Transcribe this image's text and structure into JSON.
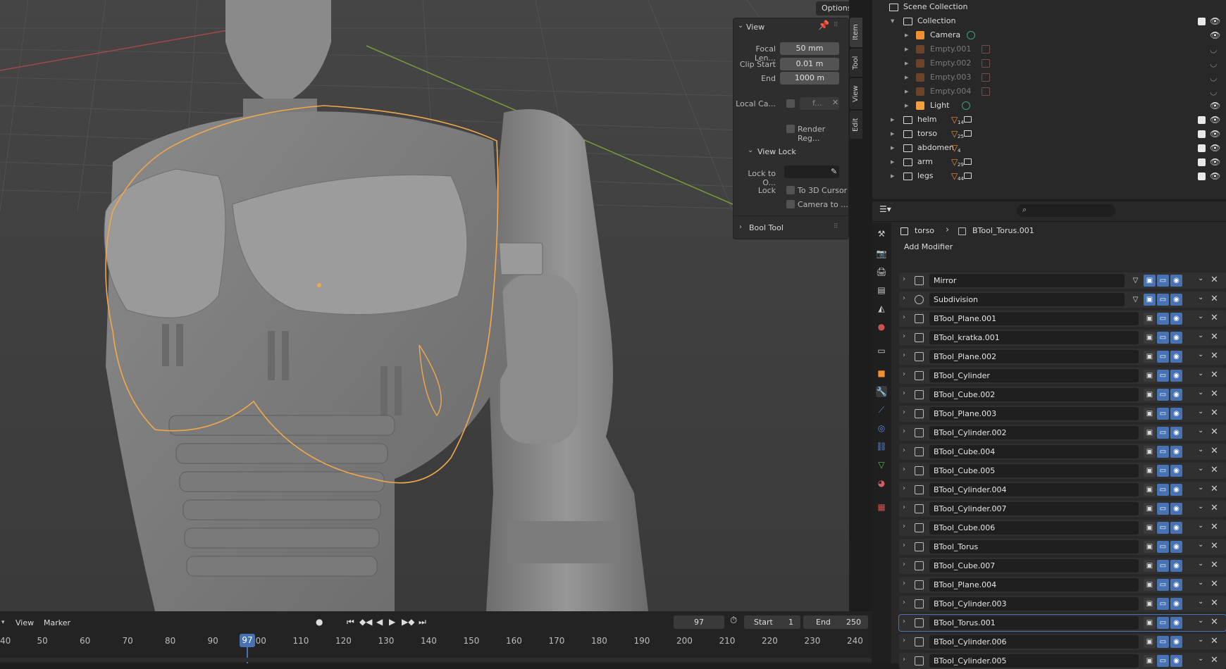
{
  "viewport": {
    "options_label": "Options",
    "npanel": {
      "view_header": "View",
      "focal_length_label": "Focal Len...",
      "focal_length_value": "50 mm",
      "clip_start_label": "Clip Start",
      "clip_start_value": "0.01 m",
      "clip_end_label": "End",
      "clip_end_value": "1000 m",
      "local_camera_label": "Local Ca...",
      "local_camera_value": "f...",
      "render_region_label": "Render Reg...",
      "view_lock_header": "View Lock",
      "lock_to_object_label": "Lock to O...",
      "lock_label": "Lock",
      "to_3d_cursor_label": "To 3D Cursor",
      "camera_to_label": "Camera to ...",
      "bool_tool_header": "Bool Tool"
    },
    "side_tabs": [
      "Item",
      "Tool",
      "View",
      "Edit"
    ]
  },
  "outliner": {
    "scene_collection": "Scene Collection",
    "collection": "Collection",
    "children": [
      {
        "name": "Camera",
        "icon": "camera-icon",
        "dim": false
      },
      {
        "name": "Empty.001",
        "icon": "empty-icon",
        "dim": true
      },
      {
        "name": "Empty.002",
        "icon": "empty-icon",
        "dim": true
      },
      {
        "name": "Empty.003",
        "icon": "empty-icon",
        "dim": true
      },
      {
        "name": "Empty.004",
        "icon": "empty-icon",
        "dim": true
      },
      {
        "name": "Light",
        "icon": "light-icon",
        "dim": false
      }
    ],
    "collections": [
      {
        "name": "helm",
        "count": "14"
      },
      {
        "name": "torso",
        "count": "25"
      },
      {
        "name": "abdomen",
        "count": "4"
      },
      {
        "name": "arm",
        "count": "29"
      },
      {
        "name": "legs",
        "count": "44"
      }
    ]
  },
  "properties": {
    "breadcrumb_object": "torso",
    "breadcrumb_modifier": "BTool_Torus.001",
    "add_modifier_label": "Add Modifier",
    "modifiers": [
      {
        "name": "Mirror",
        "type": "mirror"
      },
      {
        "name": "Subdivision",
        "type": "subdivision"
      },
      {
        "name": "BTool_Plane.001",
        "type": "boolean"
      },
      {
        "name": "BTool_kratka.001",
        "type": "boolean"
      },
      {
        "name": "BTool_Plane.002",
        "type": "boolean"
      },
      {
        "name": "BTool_Cylinder",
        "type": "boolean"
      },
      {
        "name": "BTool_Cube.002",
        "type": "boolean"
      },
      {
        "name": "BTool_Plane.003",
        "type": "boolean"
      },
      {
        "name": "BTool_Cylinder.002",
        "type": "boolean"
      },
      {
        "name": "BTool_Cube.004",
        "type": "boolean"
      },
      {
        "name": "BTool_Cube.005",
        "type": "boolean"
      },
      {
        "name": "BTool_Cylinder.004",
        "type": "boolean"
      },
      {
        "name": "BTool_Cylinder.007",
        "type": "boolean"
      },
      {
        "name": "BTool_Cube.006",
        "type": "boolean"
      },
      {
        "name": "BTool_Torus",
        "type": "boolean"
      },
      {
        "name": "BTool_Cube.007",
        "type": "boolean"
      },
      {
        "name": "BTool_Plane.004",
        "type": "boolean"
      },
      {
        "name": "BTool_Cylinder.003",
        "type": "boolean"
      },
      {
        "name": "BTool_Torus.001",
        "type": "boolean",
        "active": true
      },
      {
        "name": "BTool_Cylinder.006",
        "type": "boolean"
      },
      {
        "name": "BTool_Cylinder.005",
        "type": "boolean"
      }
    ]
  },
  "timeline": {
    "view_menu": "View",
    "marker_menu": "Marker",
    "current_frame": "97",
    "start_label": "Start",
    "start_value": "1",
    "end_label": "End",
    "end_value": "250",
    "playhead_label": "97",
    "ticks": [
      "40",
      "50",
      "60",
      "70",
      "80",
      "90",
      "100",
      "110",
      "120",
      "130",
      "140",
      "150",
      "160",
      "170",
      "180",
      "190",
      "200",
      "210",
      "220",
      "230",
      "240"
    ]
  },
  "colors": {
    "accent": "#4772b3",
    "selection_outline": "#f0a84a",
    "background": "#3d3d3d"
  }
}
